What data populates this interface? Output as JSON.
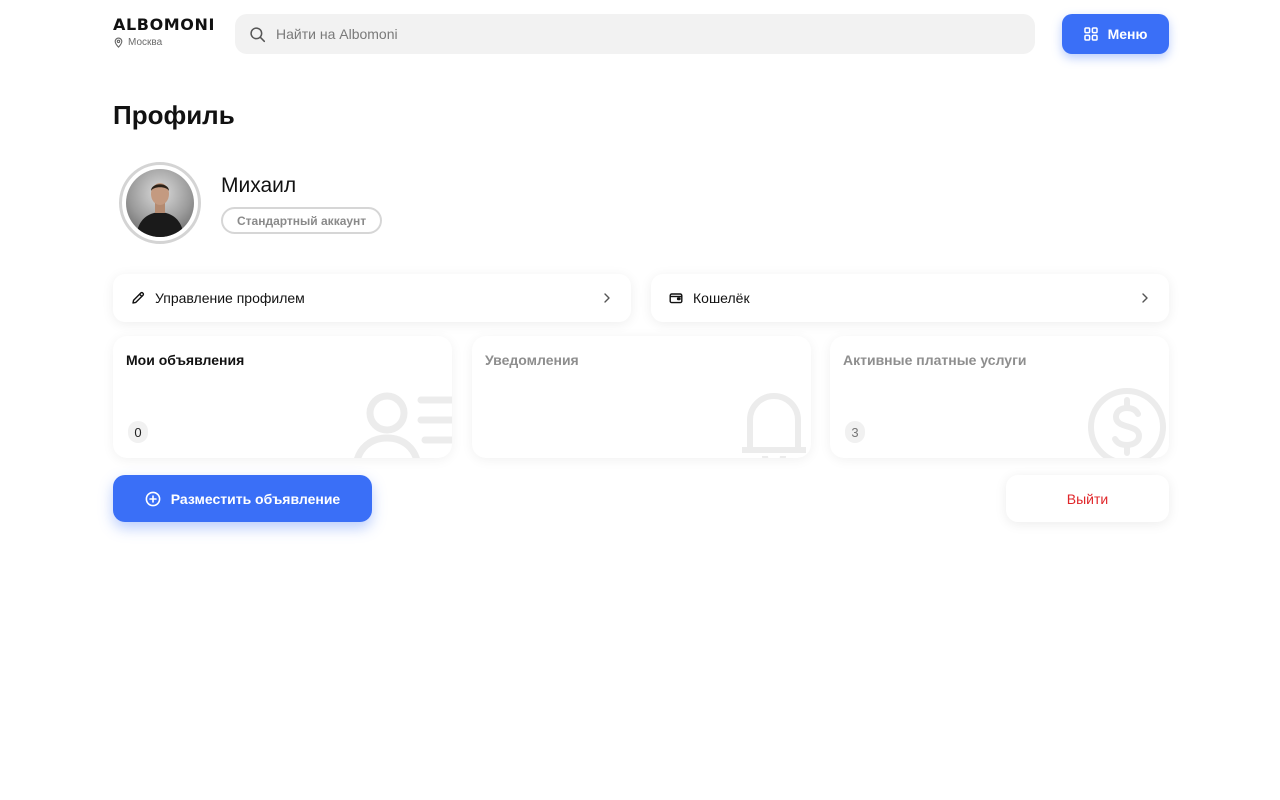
{
  "header": {
    "logo": "ALBOMONI",
    "city": "Москва",
    "search_placeholder": "Найти на Albomoni",
    "menu_label": "Меню"
  },
  "page": {
    "title": "Профиль"
  },
  "profile": {
    "name": "Михаил",
    "account_type": "Стандартный аккаунт"
  },
  "links": {
    "manage_profile": "Управление профилем",
    "wallet": "Кошелёк"
  },
  "stats": [
    {
      "title": "Мои объявления",
      "count": "0",
      "icon": "user-list-icon"
    },
    {
      "title": "Уведомления",
      "count": "",
      "icon": "bell-icon"
    },
    {
      "title": "Активные платные услуги",
      "count": "3",
      "icon": "dollar-icon"
    }
  ],
  "actions": {
    "post_ad": "Разместить объявление",
    "logout": "Выйти"
  },
  "colors": {
    "accent": "#3a6ff7",
    "danger": "#e0262a"
  }
}
